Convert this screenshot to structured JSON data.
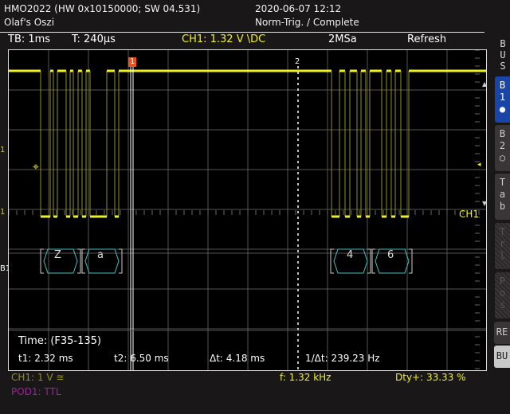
{
  "header": {
    "device": "HMO2022 (HW 0x10150000; SW 04.531)",
    "name": "Olaf's Oszi",
    "datetime": "2020-06-07 12:12",
    "trigger_status": "Norm-Trig. / Complete"
  },
  "info_bar": {
    "timebase": "TB: 1ms",
    "trigger_time": "T: 240µs",
    "channel": "CH1: 1.32 V \\DC",
    "sample_rate": "2MSa",
    "mode": "Refresh"
  },
  "screen": {
    "trigger_marker": "1",
    "cursor2_label": "2",
    "ch1_label": "CH1",
    "left_markers": {
      "trigger_level": "1",
      "ch1_ref": "1",
      "bus": "B1"
    },
    "bus_decode": [
      {
        "value": "Z"
      },
      {
        "value": "a"
      },
      {
        "value": "4"
      },
      {
        "value": "6"
      }
    ],
    "measurements": {
      "title": "Time: (F35-135)",
      "t1": "t1: 2.32 ms",
      "t2": "t2: 6.50 ms",
      "delta_t": "Δt: 4.18 ms",
      "inv_delta_t": "1/Δt: 239.23 Hz"
    }
  },
  "footer": {
    "ch1_scale": "CH1: 1 V ≅",
    "pod": "POD1: TTL",
    "frequency": "f: 1.32 kHz",
    "duty": "Dty+: 33.33 %"
  },
  "sidebar": {
    "title": [
      "B",
      "U",
      "S"
    ],
    "items": [
      {
        "label": [
          "B",
          "1",
          "●"
        ],
        "state": "active"
      },
      {
        "label": [
          "B",
          "2",
          "○"
        ],
        "state": "normal"
      },
      {
        "label": [
          "T",
          "a",
          "b"
        ],
        "state": "normal"
      },
      {
        "label": [
          "T",
          "r",
          "l"
        ],
        "state": "disabled"
      },
      {
        "label": [
          "P",
          "o",
          "s"
        ],
        "state": "disabled"
      },
      {
        "label": [
          "RE"
        ],
        "state": "normal"
      },
      {
        "label": [
          "BU"
        ],
        "state": "highlight"
      }
    ]
  },
  "colors": {
    "ch1": "#f0ef20",
    "ch1_dim": "#8f8f20",
    "bus": "#40c0c0",
    "trigger_marker": "#f05020",
    "sidebar_active": "#1a45a8",
    "pod": "#a020a0"
  }
}
